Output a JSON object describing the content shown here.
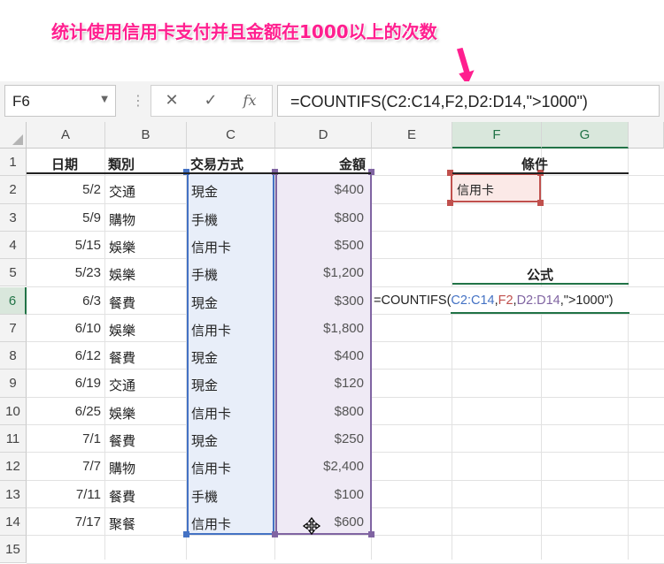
{
  "banner": {
    "title": "统计使用信用卡支付并且金额在1000以上的次数"
  },
  "formula_bar": {
    "name_box": "F6",
    "cancel_icon": "✕",
    "enter_icon": "✓",
    "fx_label": "fx",
    "formula": "=COUNTIFS(C2:C14,F2,D2:D14,\">1000\")"
  },
  "columns": [
    "A",
    "B",
    "C",
    "D",
    "E",
    "F",
    "G"
  ],
  "rows": [
    "1",
    "2",
    "3",
    "4",
    "5",
    "6",
    "7",
    "8",
    "9",
    "10",
    "11",
    "12",
    "13",
    "14",
    "15"
  ],
  "headers": {
    "date": "日期",
    "category": "類別",
    "payment": "交易方式",
    "amount": "金額"
  },
  "records": [
    {
      "date": "5/2",
      "category": "交通",
      "payment": "現金",
      "amount": "$400"
    },
    {
      "date": "5/9",
      "category": "購物",
      "payment": "手機",
      "amount": "$800"
    },
    {
      "date": "5/15",
      "category": "娛樂",
      "payment": "信用卡",
      "amount": "$500"
    },
    {
      "date": "5/23",
      "category": "娛樂",
      "payment": "手機",
      "amount": "$1,200"
    },
    {
      "date": "6/3",
      "category": "餐費",
      "payment": "現金",
      "amount": "$300"
    },
    {
      "date": "6/10",
      "category": "娛樂",
      "payment": "信用卡",
      "amount": "$1,800"
    },
    {
      "date": "6/12",
      "category": "餐費",
      "payment": "現金",
      "amount": "$400"
    },
    {
      "date": "6/19",
      "category": "交通",
      "payment": "現金",
      "amount": "$120"
    },
    {
      "date": "6/25",
      "category": "娛樂",
      "payment": "信用卡",
      "amount": "$800"
    },
    {
      "date": "7/1",
      "category": "餐費",
      "payment": "現金",
      "amount": "$250"
    },
    {
      "date": "7/7",
      "category": "購物",
      "payment": "信用卡",
      "amount": "$2,400"
    },
    {
      "date": "7/11",
      "category": "餐費",
      "payment": "手機",
      "amount": "$100"
    },
    {
      "date": "7/17",
      "category": "聚餐",
      "payment": "信用卡",
      "amount": "$600"
    }
  ],
  "criteria": {
    "header": "條件",
    "value": "信用卡"
  },
  "formula_section": {
    "header": "公式",
    "parts": [
      "=COUNTIFS(",
      "C2:C14",
      ",",
      "F2",
      ",",
      "D2:D14",
      ",\">1000\")"
    ]
  },
  "colors": {
    "banner_text": "#ff1f8f",
    "range_c_border": "#4472c4",
    "range_c_fill": "#e8eef9",
    "range_d_border": "#8064a2",
    "range_d_fill": "#efeaf5",
    "criteria_border": "#c0504d",
    "criteria_fill": "#fbe9e7",
    "excel_green": "#217346"
  }
}
